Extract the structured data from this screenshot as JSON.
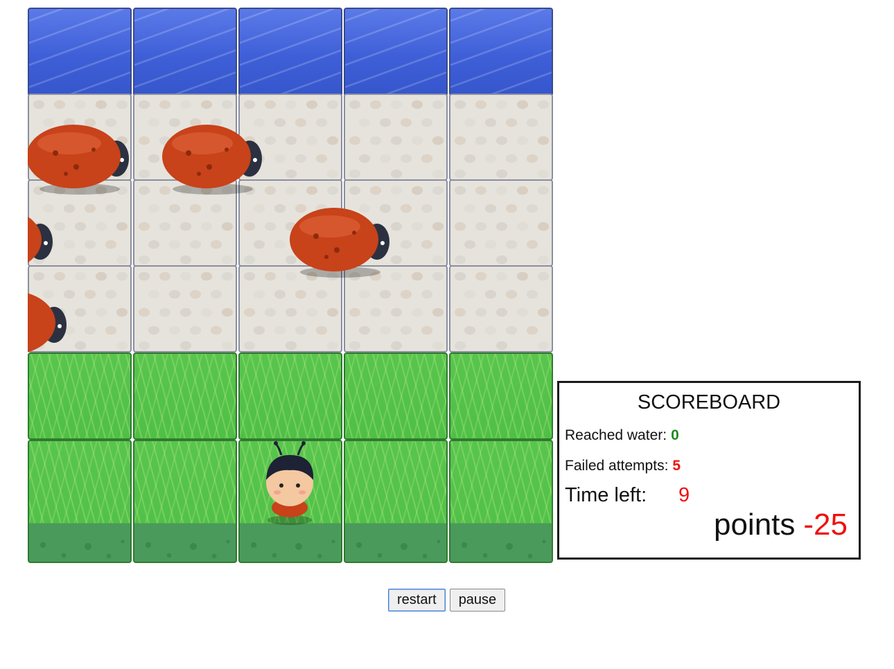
{
  "game": {
    "columns": 5,
    "rows": [
      "water",
      "stone",
      "stone",
      "stone",
      "grass",
      "grass"
    ],
    "colors": {
      "water": "#4466dd",
      "stone": "#e6e3dc",
      "grass": "#52c24a",
      "bug_body": "#c8421a",
      "bug_head": "#2b3140",
      "text_green": "#1f8a1f",
      "text_red": "#ee1111"
    },
    "player_icon": "boy-character-icon",
    "enemy_icon": "ladybug-enemy-icon"
  },
  "scoreboard": {
    "title": "SCOREBOARD",
    "reached_water_label": "Reached water:",
    "reached_water_value": "0",
    "failed_attempts_label": "Failed attempts:",
    "failed_attempts_value": "5",
    "time_left_label": "Time left:",
    "time_left_value": "9",
    "points_label": "points",
    "points_value": "-25"
  },
  "controls": {
    "restart_label": "restart",
    "pause_label": "pause"
  }
}
